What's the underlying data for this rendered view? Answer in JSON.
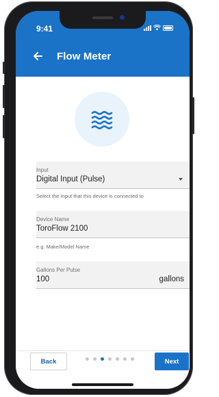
{
  "status_bar": {
    "time": "9:41"
  },
  "header": {
    "title": "Flow Meter",
    "back_icon": "arrow-left-icon"
  },
  "hero": {
    "icon": "water-waves-icon",
    "icon_color": "#1a73c6",
    "circle_color": "#e8f3fc"
  },
  "form": {
    "input": {
      "label": "Input",
      "value": "Digital Input (Pulse)",
      "helper": "Select the Input that this device is connected to"
    },
    "device_name": {
      "label": "Device Name",
      "value": "ToroFlow 2100",
      "helper": "e.g. Make/Model Name"
    },
    "gallons_per_pulse": {
      "label": "Gallons Per Pulse",
      "value": "100",
      "suffix": "gallons"
    }
  },
  "footer": {
    "back_label": "Back",
    "next_label": "Next",
    "steps_total": 7,
    "steps_current": 3
  },
  "colors": {
    "primary": "#1a73c6",
    "dot_inactive": "#c8c8c8"
  }
}
